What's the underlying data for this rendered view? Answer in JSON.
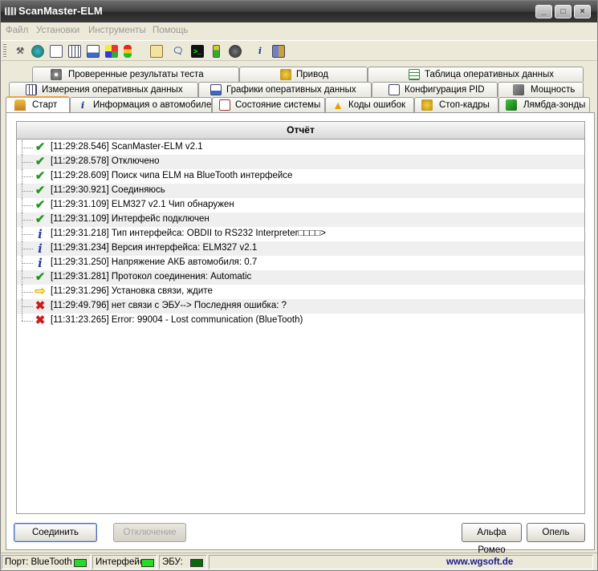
{
  "window": {
    "title": "ScanMaster-ELM"
  },
  "menu": [
    "Файл",
    "Установки",
    "Инструменты",
    "Помощь"
  ],
  "toolbar_icons": [
    "tools-icon",
    "globe-icon",
    "document-icon",
    "grid-icon",
    "chart-icon",
    "map-icon",
    "traffic-light-icon",
    "clipboard-icon",
    "chat-icon",
    "terminal-icon",
    "battery-icon",
    "gauge-icon",
    "info-icon",
    "book-icon"
  ],
  "tabs": {
    "row1": [
      {
        "label": "Проверенные результаты теста",
        "icon": "gear-icon"
      },
      {
        "label": "Привод",
        "icon": "drive-icon"
      },
      {
        "label": "Таблица оперативных данных",
        "icon": "table-icon"
      }
    ],
    "row2": [
      {
        "label": "Измерения оперативных данных",
        "icon": "grid-icon"
      },
      {
        "label": "Графики оперативных данных",
        "icon": "chart-icon"
      },
      {
        "label": "Конфигурация PID",
        "icon": "document-icon"
      },
      {
        "label": "Мощность",
        "icon": "engine-icon"
      }
    ],
    "row3": [
      {
        "label": "Старт",
        "icon": "home-icon",
        "active": true
      },
      {
        "label": "Информация о автомобиле",
        "icon": "info-icon"
      },
      {
        "label": "Состояние системы",
        "icon": "checklist-icon"
      },
      {
        "label": "Коды ошибок",
        "icon": "warning-icon"
      },
      {
        "label": "Стоп-кадры",
        "icon": "hand-icon"
      },
      {
        "label": "Лямбда-зонды",
        "icon": "sensor-icon"
      }
    ]
  },
  "report": {
    "header": "Отчёт",
    "rows": [
      {
        "status": "ok",
        "text": "[11:29:28.546] ScanMaster-ELM v2.1"
      },
      {
        "status": "ok",
        "text": "[11:29:28.578] Отключено"
      },
      {
        "status": "ok",
        "text": "[11:29:28.609] Поиск чипа ELM на BlueTooth интерфейсе"
      },
      {
        "status": "ok",
        "text": "[11:29:30.921] Соединяюсь"
      },
      {
        "status": "ok",
        "text": "[11:29:31.109] ELM327 v2.1 Чип обнаружен"
      },
      {
        "status": "ok",
        "text": "[11:29:31.109] Интерфейс подключен"
      },
      {
        "status": "info",
        "text": "[11:29:31.218] Тип интерфейса: OBDII to RS232 Interpreter□□□□>"
      },
      {
        "status": "info",
        "text": "[11:29:31.234] Версия интерфейса: ELM327 v2.1"
      },
      {
        "status": "info",
        "text": "[11:29:31.250] Напряжение АКБ автомобиля: 0.7"
      },
      {
        "status": "ok",
        "text": "[11:29:31.281] Протокол соединения: Automatic"
      },
      {
        "status": "arrow",
        "text": "[11:29:31.296] Установка связи, ждите"
      },
      {
        "status": "error",
        "text": "[11:29:49.796] нет связи с ЭБУ--> Последняя ошибка: ?"
      },
      {
        "status": "error",
        "text": "[11:31:23.265] Error: 99004 - Lost communication (BlueTooth)"
      }
    ]
  },
  "buttons": {
    "connect": "Соединить",
    "disconnect": "Отключение",
    "alfa": "Альфа Ромео",
    "options": "Опель"
  },
  "status": {
    "port_label": "Порт: BlueTooth",
    "interface_label": "Интерфейс",
    "ecu_label": "ЭБУ:",
    "port_color": "#22dd22",
    "interface_color": "#22dd22",
    "ecu_color": "#0a6a0a",
    "url": "www.wgsoft.de"
  }
}
